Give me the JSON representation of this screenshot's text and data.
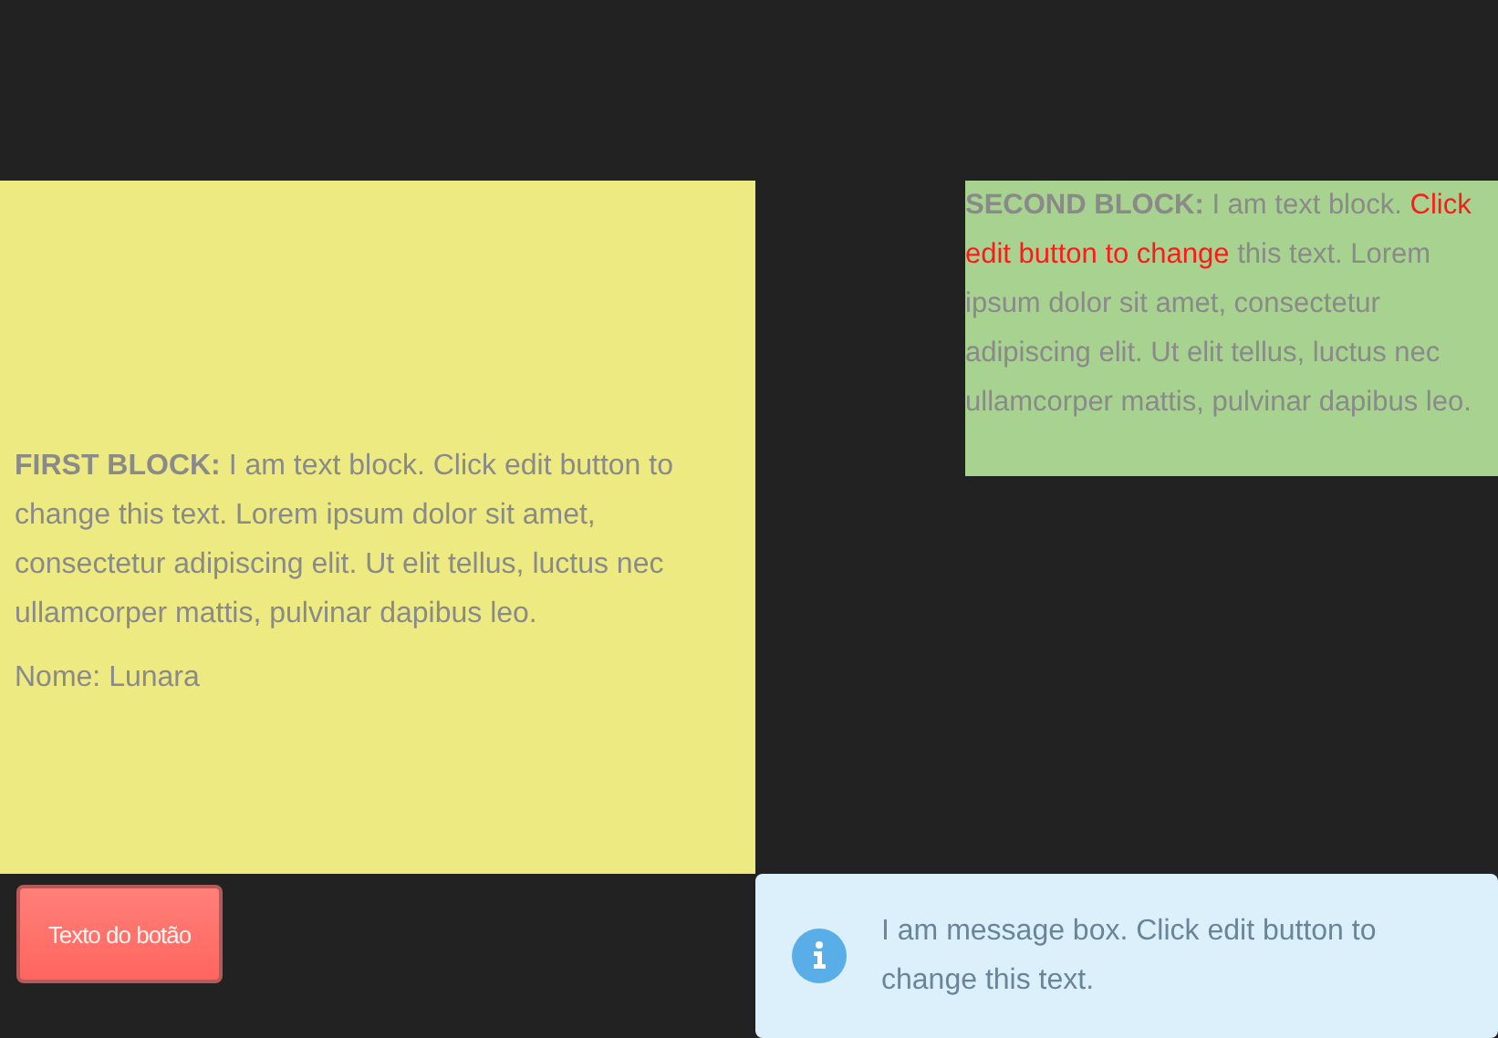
{
  "first_block": {
    "paragraph": [
      {
        "kind": "bold",
        "text": "FIRST BLOCK:"
      },
      {
        "kind": "plain",
        "text": " I am text block. Click edit button to change this text. Lorem ipsum dolor sit amet, consectetur adipiscing elit. Ut elit tellus, luctus nec ullamcorper mattis, pulvinar dapibus leo."
      }
    ],
    "name_line": "Nome: Lunara"
  },
  "second_block": {
    "paragraph": [
      {
        "kind": "bold",
        "text": "SECOND BLOCK:"
      },
      {
        "kind": "plain",
        "text": " I am text block. "
      },
      {
        "kind": "highlight",
        "text": "Click edit button to change"
      },
      {
        "kind": "plain",
        "text": " this text. Lorem ipsum dolor sit amet, consectetur adipiscing elit. Ut elit tellus, luctus nec ullamcorper mattis, pulvinar dapibus leo."
      }
    ]
  },
  "button": {
    "label": "Texto do botão"
  },
  "message_box": {
    "text": "I am message box. Click edit button to change this text."
  }
}
